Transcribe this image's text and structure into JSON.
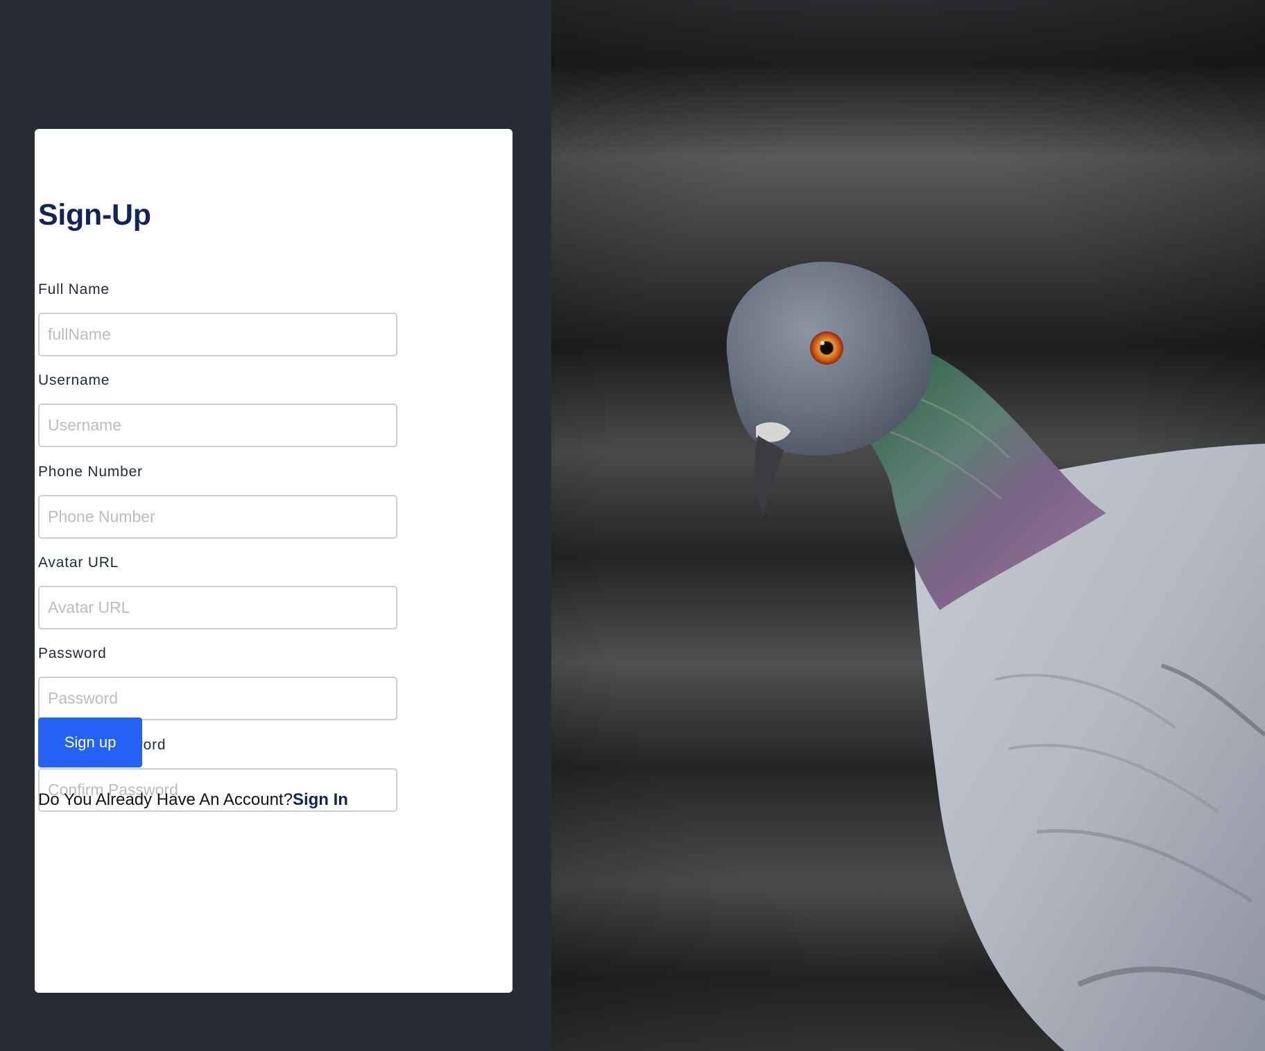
{
  "form": {
    "title": "Sign-Up",
    "fields": [
      {
        "label": "Full Name",
        "placeholder": "fullName",
        "type": "text"
      },
      {
        "label": "Username",
        "placeholder": "Username",
        "type": "text"
      },
      {
        "label": "Phone Number",
        "placeholder": "Phone Number",
        "type": "text"
      },
      {
        "label": "Avatar URL",
        "placeholder": "Avatar URL",
        "type": "text"
      },
      {
        "label": "Password",
        "placeholder": "Password",
        "type": "password"
      },
      {
        "label": "Confirm Password",
        "placeholder": "Confirm Password",
        "type": "password"
      }
    ],
    "submit_label": "Sign up",
    "signin_prompt": "Do You Already Have An Account?",
    "signin_link": "Sign In"
  },
  "colors": {
    "background": "#282c35",
    "card": "#ffffff",
    "title": "#12245a",
    "button": "#2462f6",
    "link": "#12245a"
  },
  "side_image": {
    "subject": "pigeon-photo"
  }
}
